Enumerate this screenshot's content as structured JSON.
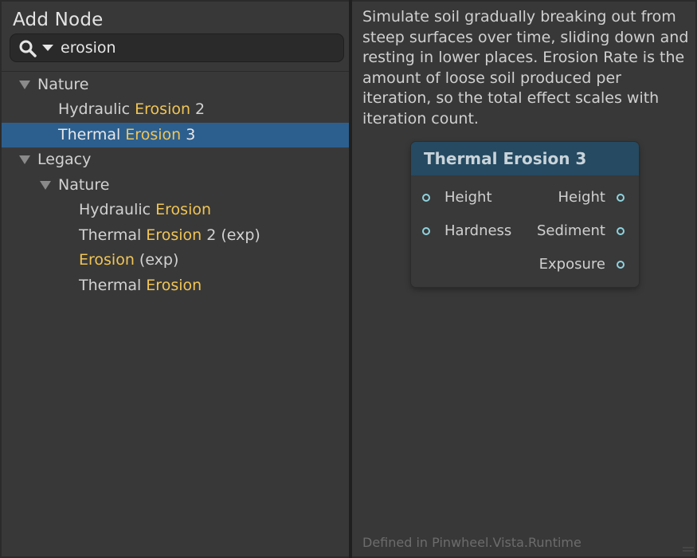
{
  "window": {
    "title": "Add Node"
  },
  "search": {
    "value": "erosion"
  },
  "tree": [
    {
      "prefix": "Nature",
      "match": "",
      "suffix": ""
    },
    {
      "prefix": "Hydraulic ",
      "match": "Erosion",
      "suffix": " 2"
    },
    {
      "prefix": "Thermal ",
      "match": "Erosion",
      "suffix": " 3"
    },
    {
      "prefix": "Legacy",
      "match": "",
      "suffix": ""
    },
    {
      "prefix": "Nature",
      "match": "",
      "suffix": ""
    },
    {
      "prefix": "Hydraulic ",
      "match": "Erosion",
      "suffix": ""
    },
    {
      "prefix": "Thermal ",
      "match": "Erosion",
      "suffix": " 2 (exp)"
    },
    {
      "prefix": "",
      "match": "Erosion",
      "suffix": " (exp)"
    },
    {
      "prefix": "Thermal ",
      "match": "Erosion",
      "suffix": ""
    }
  ],
  "description": "Simulate soil gradually breaking out from steep surfaces over time, sliding down and resting in lower places. Erosion Rate is the amount of loose soil produced per iteration, so the total effect scales with iteration count.",
  "node": {
    "title": "Thermal Erosion 3",
    "inputs": [
      "Height",
      "Hardness"
    ],
    "outputs": [
      "Height",
      "Sediment",
      "Exposure"
    ]
  },
  "footer": "Defined in Pinwheel.Vista.Runtime",
  "colors": {
    "selection": "#2d5f8e",
    "highlight": "#f1c556",
    "node_header": "#254a61",
    "port": "#8fd3df"
  }
}
